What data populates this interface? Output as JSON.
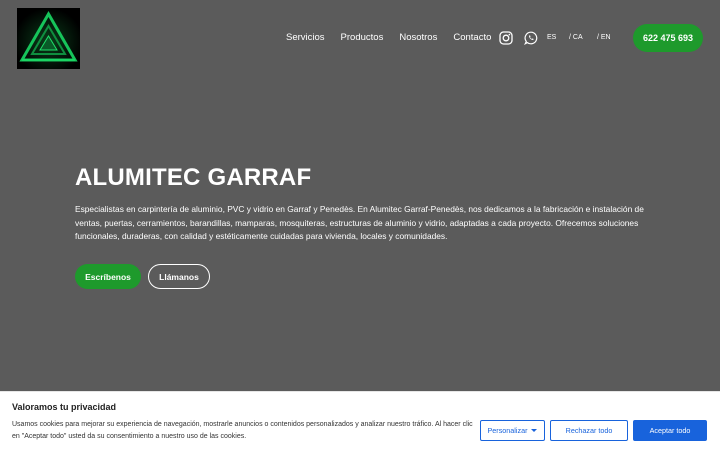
{
  "header": {
    "logo_icon": "triangle-logo-icon",
    "nav": [
      {
        "label": "Servicios"
      },
      {
        "label": "Productos"
      },
      {
        "label": "Nosotros"
      },
      {
        "label": "Contacto"
      }
    ],
    "social": [
      {
        "icon": "instagram-icon"
      },
      {
        "icon": "whatsapp-icon"
      }
    ],
    "languages": [
      "ES",
      "/ CA",
      "/ EN"
    ],
    "phone": "622 475 693"
  },
  "hero": {
    "title": "ALUMITEC GARRAF",
    "description": "Especialistas en carpintería de aluminio, PVC y vidrio en Garraf y Penedès. En Alumitec Garraf-Penedès, nos dedicamos a la fabricación e instalación de ventas, puertas, cerramientos, barandillas, mamparas, mosquiteras, estructuras de aluminio y vidrio, adaptadas a cada proyecto. Ofrecemos soluciones funcionales, duraderas, con calidad y estéticamente cuidadas para vivienda, locales y comunidades.",
    "buttons": {
      "write": "Escríbenos",
      "call": "Llámanos"
    }
  },
  "cookie_banner": {
    "title": "Valoramos tu privacidad",
    "text": "Usamos cookies para mejorar su experiencia de navegación, mostrarle anuncios o contenidos personalizados y analizar nuestro tráfico. Al hacer clic en \"Aceptar todo\" usted da su consentimiento a nuestro uso de las cookies.",
    "customize": "Personalizar",
    "reject": "Rechazar todo",
    "accept": "Aceptar todo"
  },
  "colors": {
    "background": "#5b5b5b",
    "brand_green": "#1e9a2c",
    "cookie_blue": "#1863dc"
  }
}
